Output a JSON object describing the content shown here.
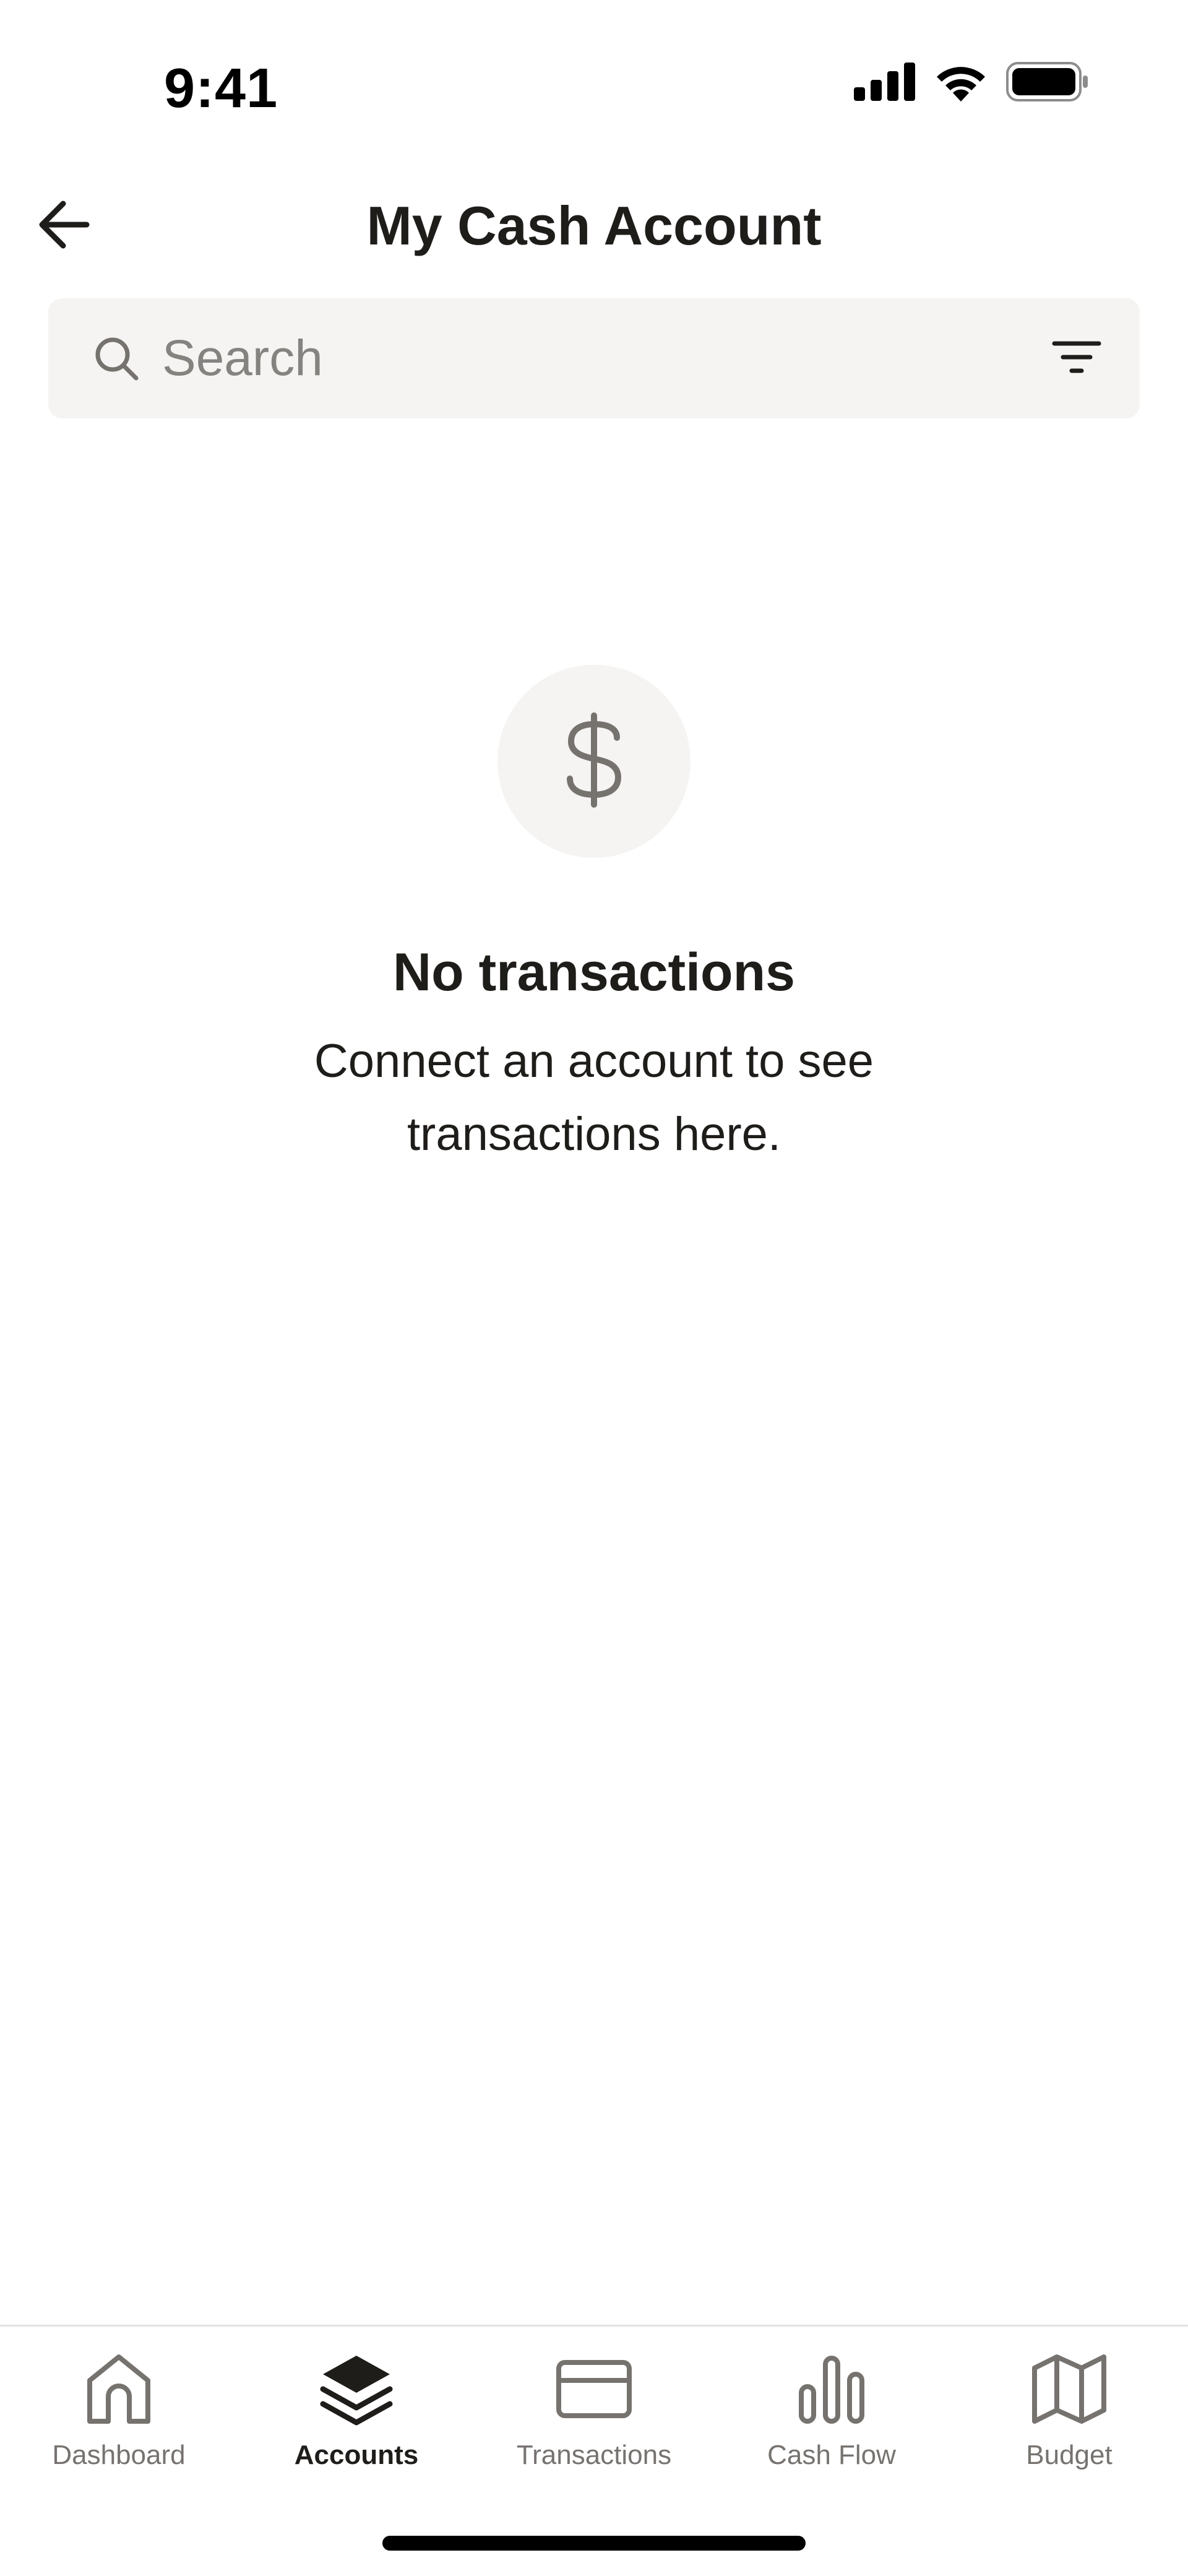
{
  "status_bar": {
    "time": "9:41",
    "icons": [
      "cellular-signal-icon",
      "wifi-icon",
      "battery-icon"
    ]
  },
  "header": {
    "title": "My Cash Account",
    "back_icon": "arrow-left-icon"
  },
  "search": {
    "placeholder": "Search",
    "value": "",
    "icon": "search-icon",
    "filter_icon": "filter-icon"
  },
  "empty_state": {
    "icon": "dollar-sign-icon",
    "title": "No transactions",
    "subtitle": "Connect an account to see transactions here."
  },
  "tabs": [
    {
      "label": "Dashboard",
      "icon": "home-icon",
      "active": false
    },
    {
      "label": "Accounts",
      "icon": "layers-icon",
      "active": true
    },
    {
      "label": "Transactions",
      "icon": "credit-card-icon",
      "active": false
    },
    {
      "label": "Cash Flow",
      "icon": "bar-chart-icon",
      "active": false
    },
    {
      "label": "Budget",
      "icon": "map-icon",
      "active": false
    }
  ],
  "colors": {
    "text_primary": "#1f1d1a",
    "text_secondary": "#76736f",
    "surface_muted": "#f5f4f2",
    "divider": "#e4e2df"
  }
}
